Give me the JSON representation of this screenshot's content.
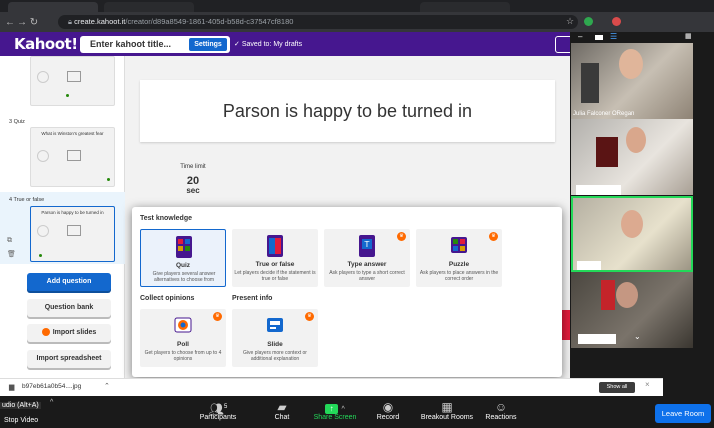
{
  "browser": {
    "url_host": "create.kahoot.it",
    "url_path": "/creator/d89a8549-1861-405d-b58d-c37547cf8180"
  },
  "kahoot": {
    "logo": "Kahoot!",
    "title_placeholder": "Enter kahoot title...",
    "settings_label": "Settings",
    "saved_text": "Saved to: My drafts",
    "question_title": "Parson is happy to be turned in",
    "time_limit_label": "Time limit",
    "time_limit_value": "20",
    "time_limit_unit": "sec"
  },
  "sidebar": {
    "slide3_label": "3 Quiz",
    "slide3_title": "What is Winston's greatest fear",
    "slide4_label": "4 True or false",
    "slide4_title": "Parson is happy to be turned in",
    "add_question": "Add question",
    "question_bank": "Question bank",
    "import_slides": "Import slides",
    "import_spreadsheet": "Import spreadsheet"
  },
  "modal": {
    "section_test": "Test knowledge",
    "section_opinions": "Collect opinions",
    "section_present": "Present info",
    "cards": [
      {
        "label": "Quiz",
        "desc": "Give players several answer alternatives to choose from"
      },
      {
        "label": "True or false",
        "desc": "Let players decide if the statement is true or false"
      },
      {
        "label": "Type answer",
        "desc": "Ask players to type a short correct answer"
      },
      {
        "label": "Puzzle",
        "desc": "Ask players to place answers in the correct order"
      },
      {
        "label": "Poll",
        "desc": "Get players to choose from up to 4 opinions"
      },
      {
        "label": "Slide",
        "desc": "Give players more context or additional explanation"
      }
    ]
  },
  "video": {
    "name1": "Julia Falconer ORegan"
  },
  "downloads": {
    "file": "b97eb61a0b54....jpg",
    "show_all": "Show all",
    "close": "×"
  },
  "zoom": {
    "audio_tooltip": "udio (Alt+A)",
    "stop_video": "Stop Video",
    "participants": "Participants",
    "participants_count": "5",
    "chat": "Chat",
    "share_screen": "Share Screen",
    "record": "Record",
    "breakout": "Breakout Rooms",
    "reactions": "Reactions",
    "leave": "Leave Room"
  },
  "colors": {
    "kahoot_purple": "#46178f",
    "kahoot_blue": "#1368ce",
    "kahoot_red": "#e21b3c",
    "share_green": "#23d959",
    "zoom_blue": "#0e71eb"
  }
}
